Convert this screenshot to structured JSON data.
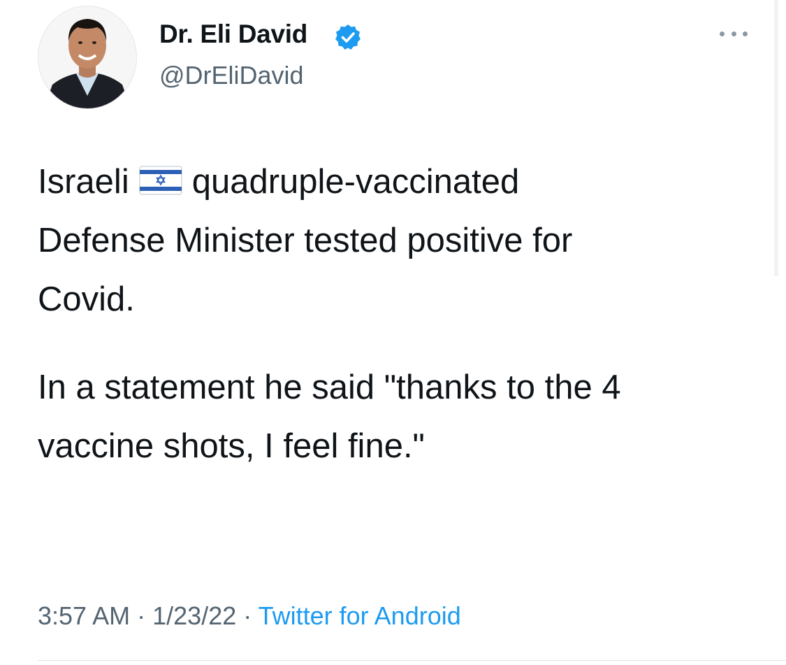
{
  "author": {
    "display_name": "Dr. Eli David",
    "handle": "@DrEliDavid",
    "verified": true
  },
  "tweet": {
    "paragraph1": {
      "line1_before_flag": "Israeli",
      "flag_icon": "israel-flag-emoji",
      "line1_after_flag": "quadruple-vaccinated",
      "line2": "Defense Minister tested positive for",
      "line3": "Covid."
    },
    "paragraph2": {
      "line1": "In a statement he said \"thanks to the 4",
      "line2": "vaccine shots, I feel fine.\""
    }
  },
  "meta": {
    "time": "3:57 AM",
    "separator": "·",
    "date": "1/23/22",
    "source": "Twitter for Android"
  },
  "colors": {
    "text": "#0f1419",
    "secondary": "#536471",
    "accent": "#1d9bf0",
    "verified_badge": "#1d9bf0"
  },
  "icons": {
    "verified": "verified-badge-icon",
    "more": "more-options-icon"
  }
}
